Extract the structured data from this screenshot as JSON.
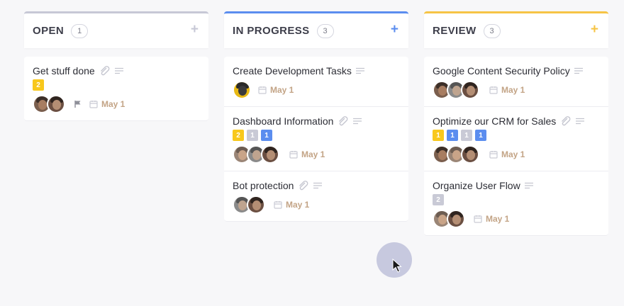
{
  "colors": {
    "open_accent": "#c7c8d6",
    "progress_accent": "#5b8def",
    "review_accent": "#f6c445",
    "badge_yellow": "#f8c81c",
    "badge_gray": "#c9cad6",
    "badge_blue": "#5b8def",
    "due": "#c3a486"
  },
  "columns": [
    {
      "title": "OPEN",
      "count": "1",
      "add_icon": "plus-icon",
      "cards": [
        {
          "title": "Get stuff done",
          "badges": [
            "2"
          ],
          "due": "May 1"
        }
      ]
    },
    {
      "title": "IN PROGRESS",
      "count": "3",
      "add_icon": "plus-icon",
      "cards": [
        {
          "title": "Create Development Tasks",
          "badges": [],
          "due": "May 1"
        },
        {
          "title": "Dashboard Information",
          "badges": [
            "2",
            "1",
            "1"
          ],
          "due": "May 1"
        },
        {
          "title": "Bot protection",
          "badges": [],
          "due": "May 1"
        }
      ]
    },
    {
      "title": "REVIEW",
      "count": "3",
      "add_icon": "plus-icon",
      "cards": [
        {
          "title": "Google Content Security Policy",
          "badges": [],
          "due": "May 1"
        },
        {
          "title": "Optimize our CRM for Sales",
          "badges": [
            "1",
            "1",
            "1",
            "1"
          ],
          "due": "May 1"
        },
        {
          "title": "Organize User Flow",
          "badges": [
            "2"
          ],
          "due": "May 1"
        }
      ]
    }
  ]
}
